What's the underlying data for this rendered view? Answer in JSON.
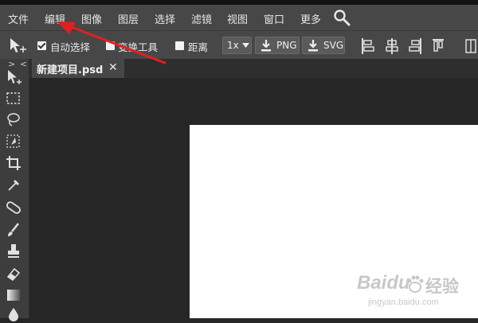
{
  "menu": {
    "items": [
      "文件",
      "编辑",
      "图像",
      "图层",
      "选择",
      "滤镜",
      "视图",
      "窗口",
      "更多"
    ],
    "search_icon": "search-icon"
  },
  "toolbar": {
    "auto_select_label": "自动选择",
    "auto_select_checked": true,
    "transform_label": "变换工具",
    "transform_checked": false,
    "distance_label": "距离",
    "distance_checked": false,
    "zoom_value": "1x",
    "png_label": "PNG",
    "svg_label": "SVG"
  },
  "tab": {
    "title": "新建项目.psd",
    "close_symbol": "✕"
  },
  "sidebar": {
    "collapse_symbol": "> <",
    "tools": [
      "move-tool",
      "marquee-tool",
      "lasso-tool",
      "quick-select-tool",
      "crop-tool",
      "eyedropper-tool",
      "healing-brush-tool",
      "brush-tool",
      "stamp-tool",
      "eraser-tool",
      "gradient-tool",
      "blur-tool"
    ]
  },
  "annotation": {
    "color": "#e02020"
  },
  "watermark": {
    "brand": "Baidu",
    "cn": "经验",
    "url": "jingyan.baidu.com"
  }
}
